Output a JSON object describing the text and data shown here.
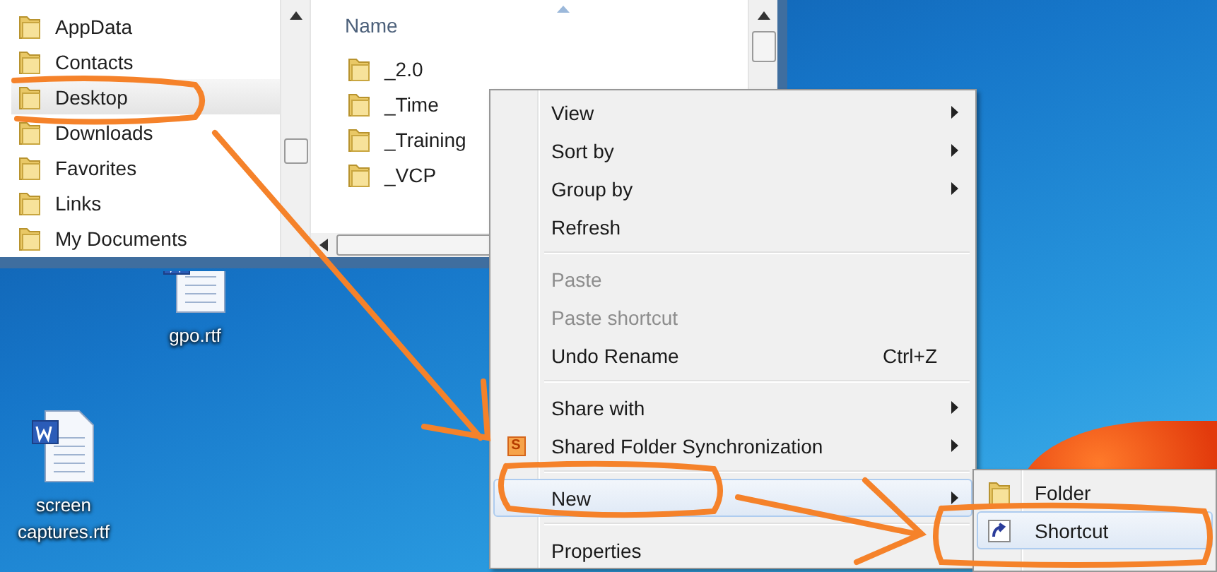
{
  "explorer": {
    "navigation_pane": {
      "items": [
        {
          "label": "AppData",
          "selected": false
        },
        {
          "label": "Contacts",
          "selected": false
        },
        {
          "label": "Desktop",
          "selected": true
        },
        {
          "label": "Downloads",
          "selected": false
        },
        {
          "label": "Favorites",
          "selected": false
        },
        {
          "label": "Links",
          "selected": false
        },
        {
          "label": "My Documents",
          "selected": false
        }
      ]
    },
    "file_list": {
      "column_header": "Name",
      "items": [
        {
          "label": "_2.0"
        },
        {
          "label": "_Time"
        },
        {
          "label": "_Training"
        },
        {
          "label": "_VCP"
        }
      ]
    }
  },
  "desktop_icons": [
    {
      "label": "gpo.rtf"
    },
    {
      "label": "screen captures.rtf"
    }
  ],
  "context_menu": {
    "items": [
      {
        "kind": "item",
        "label": "View",
        "disabled": false,
        "has_submenu": true,
        "selected": false
      },
      {
        "kind": "item",
        "label": "Sort by",
        "disabled": false,
        "has_submenu": true,
        "selected": false
      },
      {
        "kind": "item",
        "label": "Group by",
        "disabled": false,
        "has_submenu": true,
        "selected": false
      },
      {
        "kind": "item",
        "label": "Refresh",
        "disabled": false,
        "has_submenu": false,
        "selected": false
      },
      {
        "kind": "separator"
      },
      {
        "kind": "item",
        "label": "Paste",
        "disabled": true,
        "has_submenu": false,
        "selected": false
      },
      {
        "kind": "item",
        "label": "Paste shortcut",
        "disabled": true,
        "has_submenu": false,
        "selected": false
      },
      {
        "kind": "item",
        "label": "Undo Rename",
        "shortcut": "Ctrl+Z",
        "disabled": false,
        "has_submenu": false,
        "selected": false
      },
      {
        "kind": "separator"
      },
      {
        "kind": "item",
        "label": "Share with",
        "disabled": false,
        "has_submenu": true,
        "selected": false
      },
      {
        "kind": "item",
        "label": "Shared Folder Synchronization",
        "icon_text": "S",
        "disabled": false,
        "has_submenu": true,
        "selected": false
      },
      {
        "kind": "separator"
      },
      {
        "kind": "item",
        "label": "New",
        "disabled": false,
        "has_submenu": true,
        "selected": true
      },
      {
        "kind": "separator"
      },
      {
        "kind": "item",
        "label": "Properties",
        "disabled": false,
        "has_submenu": false,
        "selected": false
      }
    ]
  },
  "submenu": {
    "items": [
      {
        "label": "Folder",
        "selected": false
      },
      {
        "label": "Shortcut",
        "selected": true
      }
    ]
  }
}
